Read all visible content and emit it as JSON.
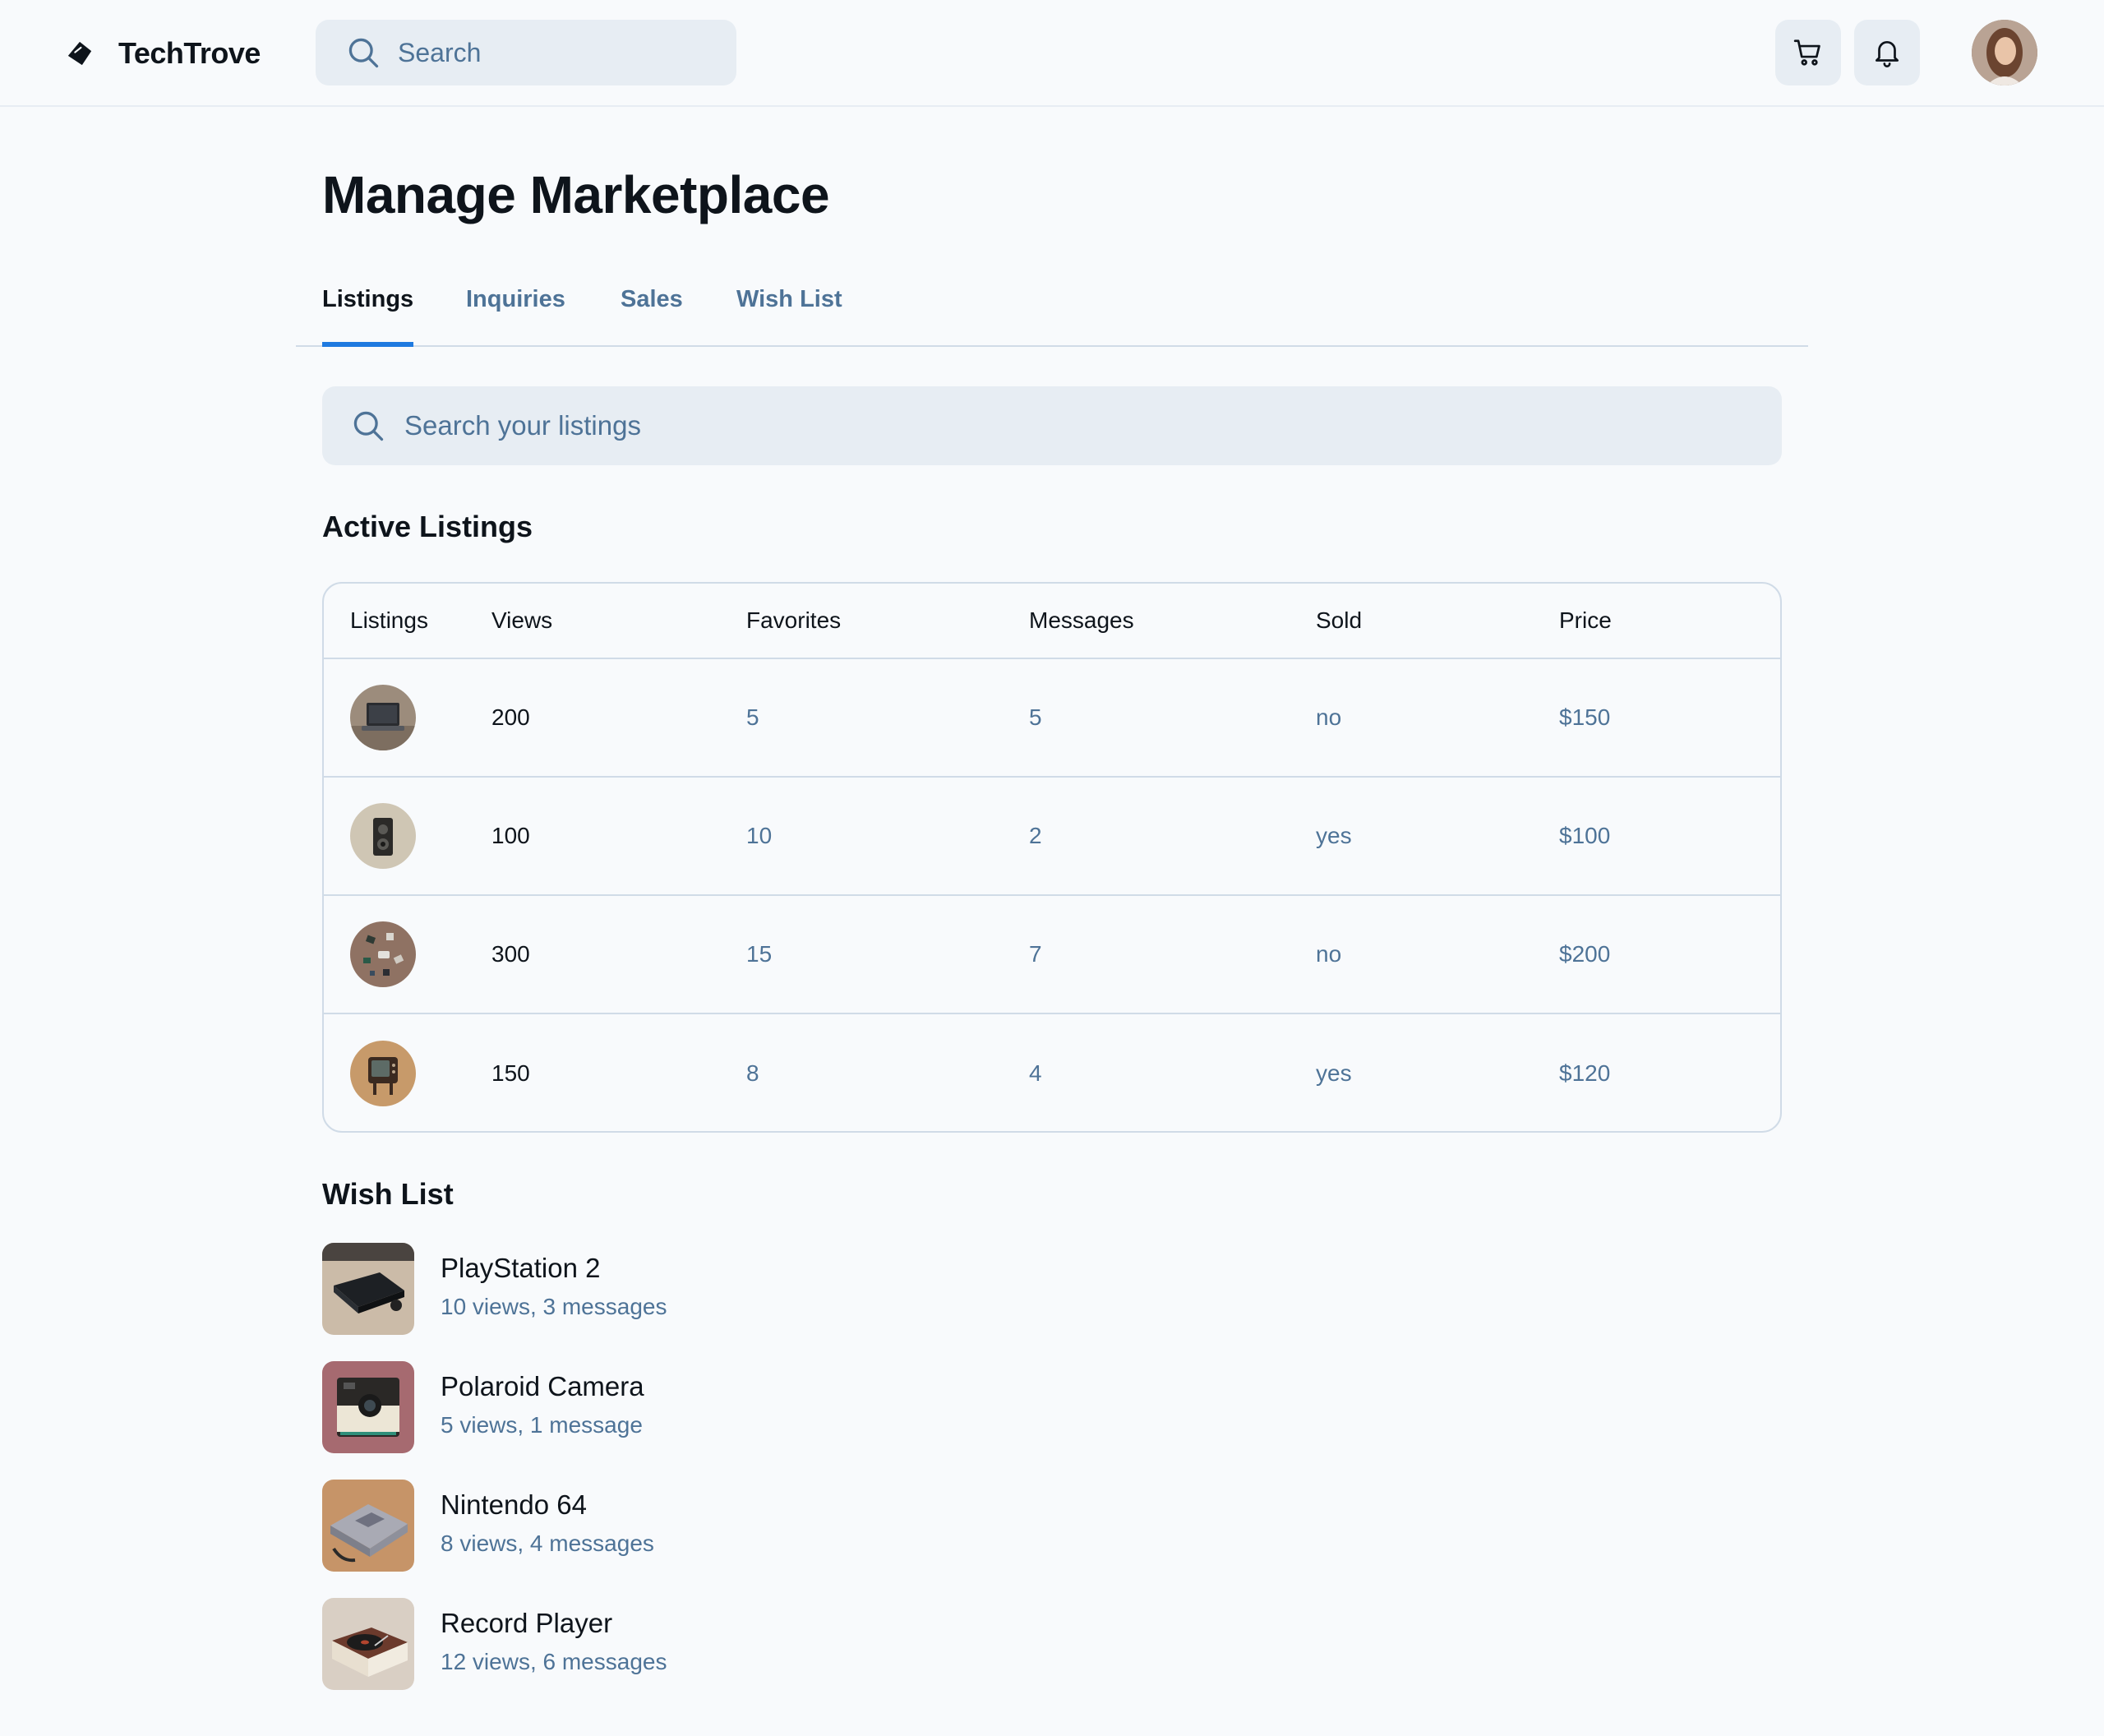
{
  "app": {
    "brand": "TechTrove"
  },
  "header": {
    "search_placeholder": "Search"
  },
  "page": {
    "title": "Manage Marketplace"
  },
  "tabs": [
    {
      "label": "Listings",
      "active": true
    },
    {
      "label": "Inquiries",
      "active": false
    },
    {
      "label": "Sales",
      "active": false
    },
    {
      "label": "Wish List",
      "active": false
    }
  ],
  "listing_search": {
    "placeholder": "Search your listings"
  },
  "active_listings": {
    "title": "Active Listings",
    "columns": [
      "Listings",
      "Views",
      "Favorites",
      "Messages",
      "Sold",
      "Price"
    ],
    "rows": [
      {
        "thumb": "laptop-thumbnail",
        "views": "200",
        "favorites": "5",
        "messages": "5",
        "sold": "no",
        "price": "$150"
      },
      {
        "thumb": "vintage-camera-thumbnail",
        "views": "100",
        "favorites": "10",
        "messages": "2",
        "sold": "yes",
        "price": "$100"
      },
      {
        "thumb": "electronic-parts-thumbnail",
        "views": "300",
        "favorites": "15",
        "messages": "7",
        "sold": "no",
        "price": "$200"
      },
      {
        "thumb": "retro-tv-thumbnail",
        "views": "150",
        "favorites": "8",
        "messages": "4",
        "sold": "yes",
        "price": "$120"
      }
    ]
  },
  "wish_list": {
    "title": "Wish List",
    "items": [
      {
        "name": "PlayStation 2",
        "stats": "10 views, 3 messages"
      },
      {
        "name": "Polaroid Camera",
        "stats": "5 views, 1 message"
      },
      {
        "name": "Nintendo 64",
        "stats": "8 views, 4 messages"
      },
      {
        "name": "Record Player",
        "stats": "12 views, 6 messages"
      }
    ]
  },
  "colors": {
    "accent": "#1f7ae0",
    "muted_text": "#4e7397",
    "border": "#d0dbe7",
    "input_bg": "#e7edf3"
  },
  "icons": [
    "brand-logo-icon",
    "search-icon",
    "cart-icon",
    "bell-icon"
  ]
}
